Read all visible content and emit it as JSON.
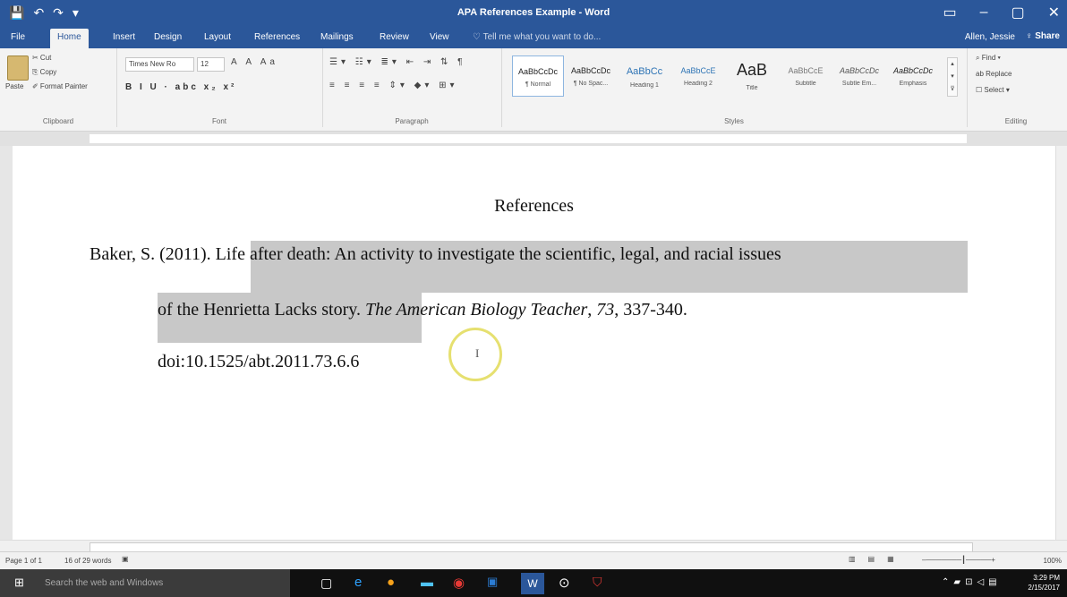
{
  "titlebar": {
    "qat": [
      "💾",
      "↶",
      "↷",
      "▾"
    ],
    "title": "APA References Example - Word",
    "buttons": [
      "▭",
      "–",
      "▢",
      "✕"
    ]
  },
  "tabs": [
    "File",
    "Home",
    "Insert",
    "Design",
    "Layout",
    "References",
    "Mailings",
    "Review",
    "View"
  ],
  "tell_me": "♡ Tell me what you want to do...",
  "user": "Allen, Jessie",
  "share": "♀ Share",
  "clipboard": {
    "paste": "Paste",
    "cut": "✂ Cut",
    "copy": "⎘ Copy",
    "format_painter": "✐ Format Painter",
    "label": "Clipboard"
  },
  "font": {
    "name": "Times New Ro",
    "size": "12",
    "label": "Font",
    "format_row": "B I U · abc x₂ x²"
  },
  "paragraph": {
    "label": "Paragraph"
  },
  "styles": {
    "items": [
      {
        "sample": "AaBbCcDc",
        "name": "¶ Normal"
      },
      {
        "sample": "AaBbCcDc",
        "name": "¶ No Spac..."
      },
      {
        "sample": "AaBbCc",
        "name": "Heading 1"
      },
      {
        "sample": "AaBbCcE",
        "name": "Heading 2"
      },
      {
        "sample": "AaB",
        "name": "Title"
      },
      {
        "sample": "AaBbCcE",
        "name": "Subtitle"
      },
      {
        "sample": "AaBbCcDc",
        "name": "Subtle Em..."
      },
      {
        "sample": "AaBbCcDc",
        "name": "Emphasis"
      }
    ],
    "label": "Styles"
  },
  "editing": {
    "find": "⌕ Find ▾",
    "replace": "ab Replace",
    "select": "☐ Select ▾",
    "label": "Editing"
  },
  "document": {
    "heading": "References",
    "line1_author": "Baker, S. (2011).",
    "line1_title": "Life after death: An activity to investigate the scientific, legal, and racial issues",
    "line2_a": "of the Henrietta Lacks story.",
    "line2_journal": "The American Biology Teacher",
    "line2_comma": ",",
    "line2_volume": "73",
    "line2_pages": ", 337-340.",
    "line3": "doi:10.1525/abt.2011.73.6.6"
  },
  "status": {
    "page": "Page 1 of 1",
    "words": "16 of 29 words",
    "zoom": "100%"
  },
  "taskbar": {
    "search": "Search the web and Windows",
    "time": "3:29 PM",
    "date": "2/15/2017"
  },
  "colors": {
    "word_blue": "#2b579a",
    "selection": "#c8c8c8",
    "cursor_ring": "#e6e070"
  }
}
